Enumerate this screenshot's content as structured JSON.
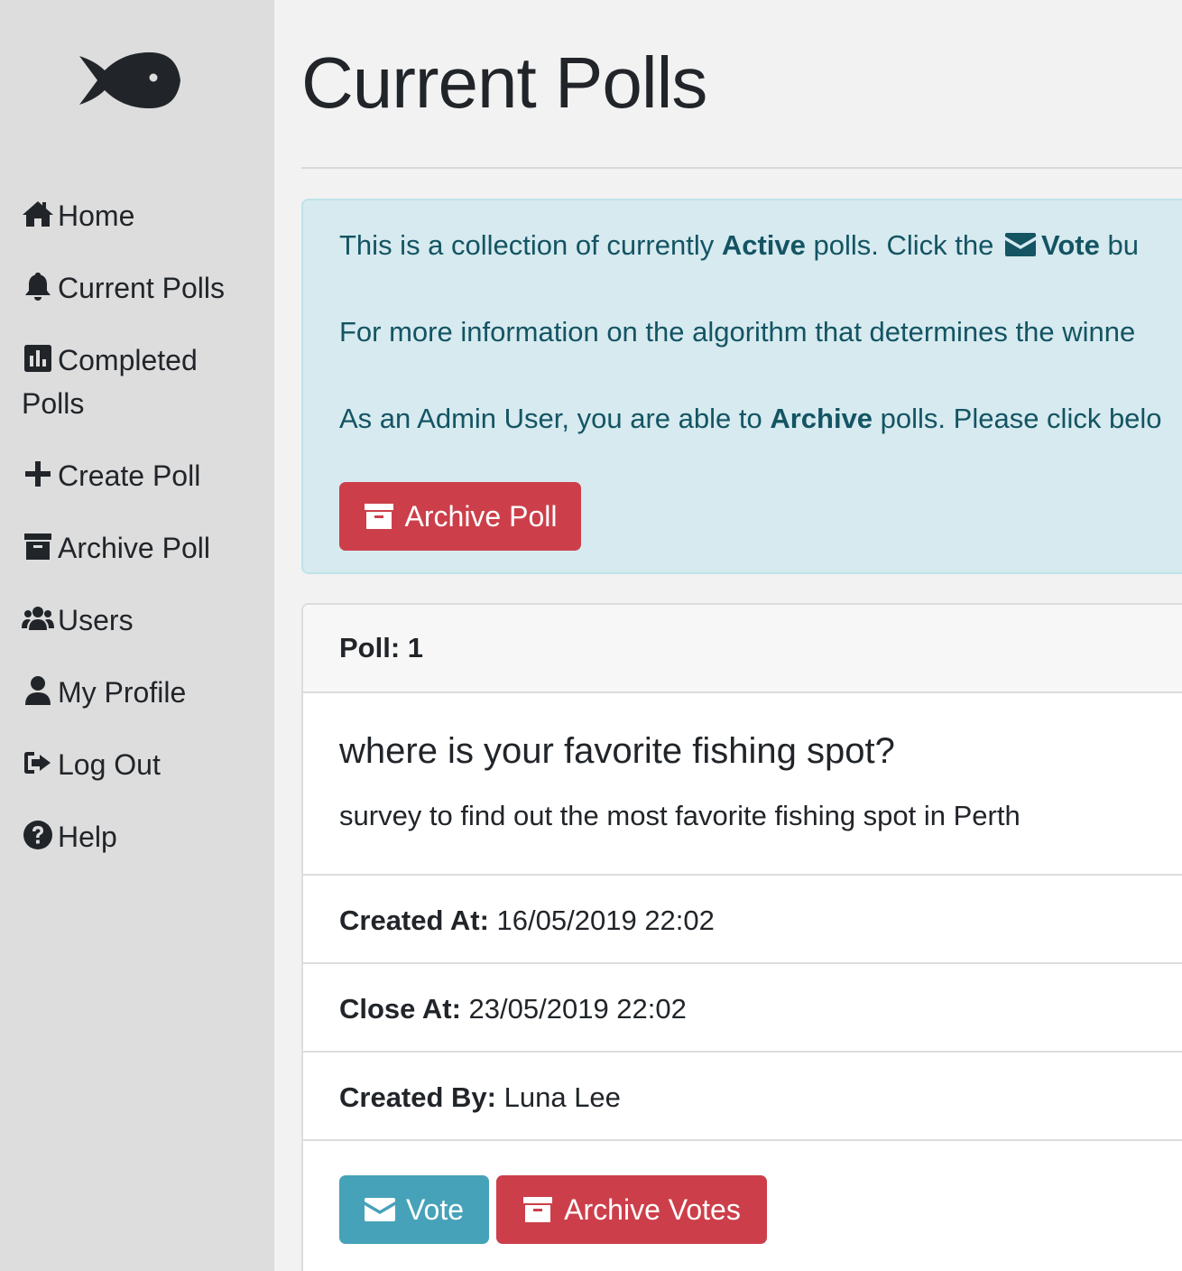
{
  "sidebar": {
    "logo": "fish-icon",
    "items": [
      {
        "label": "Home",
        "icon": "home-icon"
      },
      {
        "label": "Current Polls",
        "icon": "bell-icon"
      },
      {
        "label": "Completed",
        "label2": "Polls",
        "icon": "chart-icon"
      },
      {
        "label": "Create Poll",
        "icon": "plus-icon"
      },
      {
        "label": "Archive Poll",
        "icon": "archive-icon"
      },
      {
        "label": "Users",
        "icon": "users-icon"
      },
      {
        "label": "My Profile",
        "icon": "user-icon"
      },
      {
        "label": "Log Out",
        "icon": "sign-out-icon"
      },
      {
        "label": "Help",
        "icon": "question-icon"
      }
    ]
  },
  "main": {
    "title": "Current Polls",
    "alert": {
      "line1_a": "This is a collection of currently ",
      "line1_b": "Active",
      "line1_c": " polls. Click the ",
      "line1_d": "Vote",
      "line1_e": " bu",
      "line2": "For more information on the algorithm that determines the winne",
      "line3_a": "As an Admin User, you are able to ",
      "line3_b": "Archive",
      "line3_c": " polls. Please click belo",
      "button": "Archive Poll"
    },
    "poll": {
      "header": "Poll: 1",
      "question": "where is your favorite fishing spot?",
      "description": "survey to find out the most favorite fishing spot in Perth",
      "created_at_label": "Created At:",
      "created_at": " 16/05/2019 22:02",
      "close_at_label": "Close At:",
      "close_at": " 23/05/2019 22:02",
      "created_by_label": "Created By:",
      "created_by": " Luna Lee",
      "vote_button": "Vote",
      "archive_votes_button": "Archive Votes"
    }
  },
  "colors": {
    "sidebar_bg": "#dddddd",
    "alert_bg": "#d6eaef",
    "alert_text": "#145463",
    "danger": "#cc3f4a",
    "info": "#46a2b9"
  }
}
